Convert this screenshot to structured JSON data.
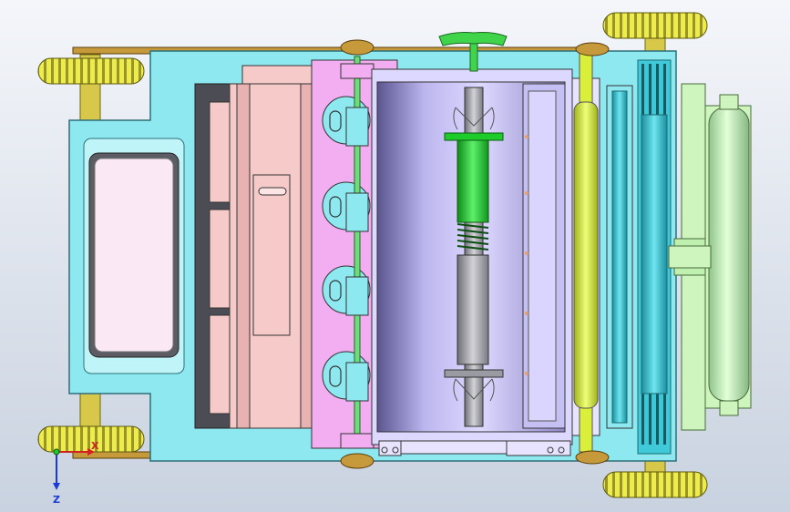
{
  "viewport": {
    "background_top": "#f4f6fa",
    "background_bottom": "#c9d2e0"
  },
  "colors": {
    "housing": "#8ee8f0",
    "housing_edge": "#2f6f78",
    "wheel": "#eeec4a",
    "wheel_edge": "#6b6a10",
    "axle": "#d8c84a",
    "frame_rail": "#c69a3a",
    "dark_panel": "#4c4c54",
    "pink_block": "#f7caca",
    "magenta_block": "#f2aef0",
    "drum": "#bcb6ef",
    "drum_dark": "#6f68a8",
    "screw_green": "#1dcc2a",
    "screw_gray": "#9a9aa2",
    "yellow_roller": "#d9ef39",
    "teal_roller": "#3fc9d9",
    "green_roller": "#c8f2b8",
    "mint_frame": "#cff5bf",
    "light_panel": "#fbe8f5"
  },
  "icons": {
    "axis_triad": "axis-triad-icon",
    "knob": "handwheel-icon"
  },
  "axis_triad": {
    "x_label": "X",
    "z_label": "Z"
  }
}
